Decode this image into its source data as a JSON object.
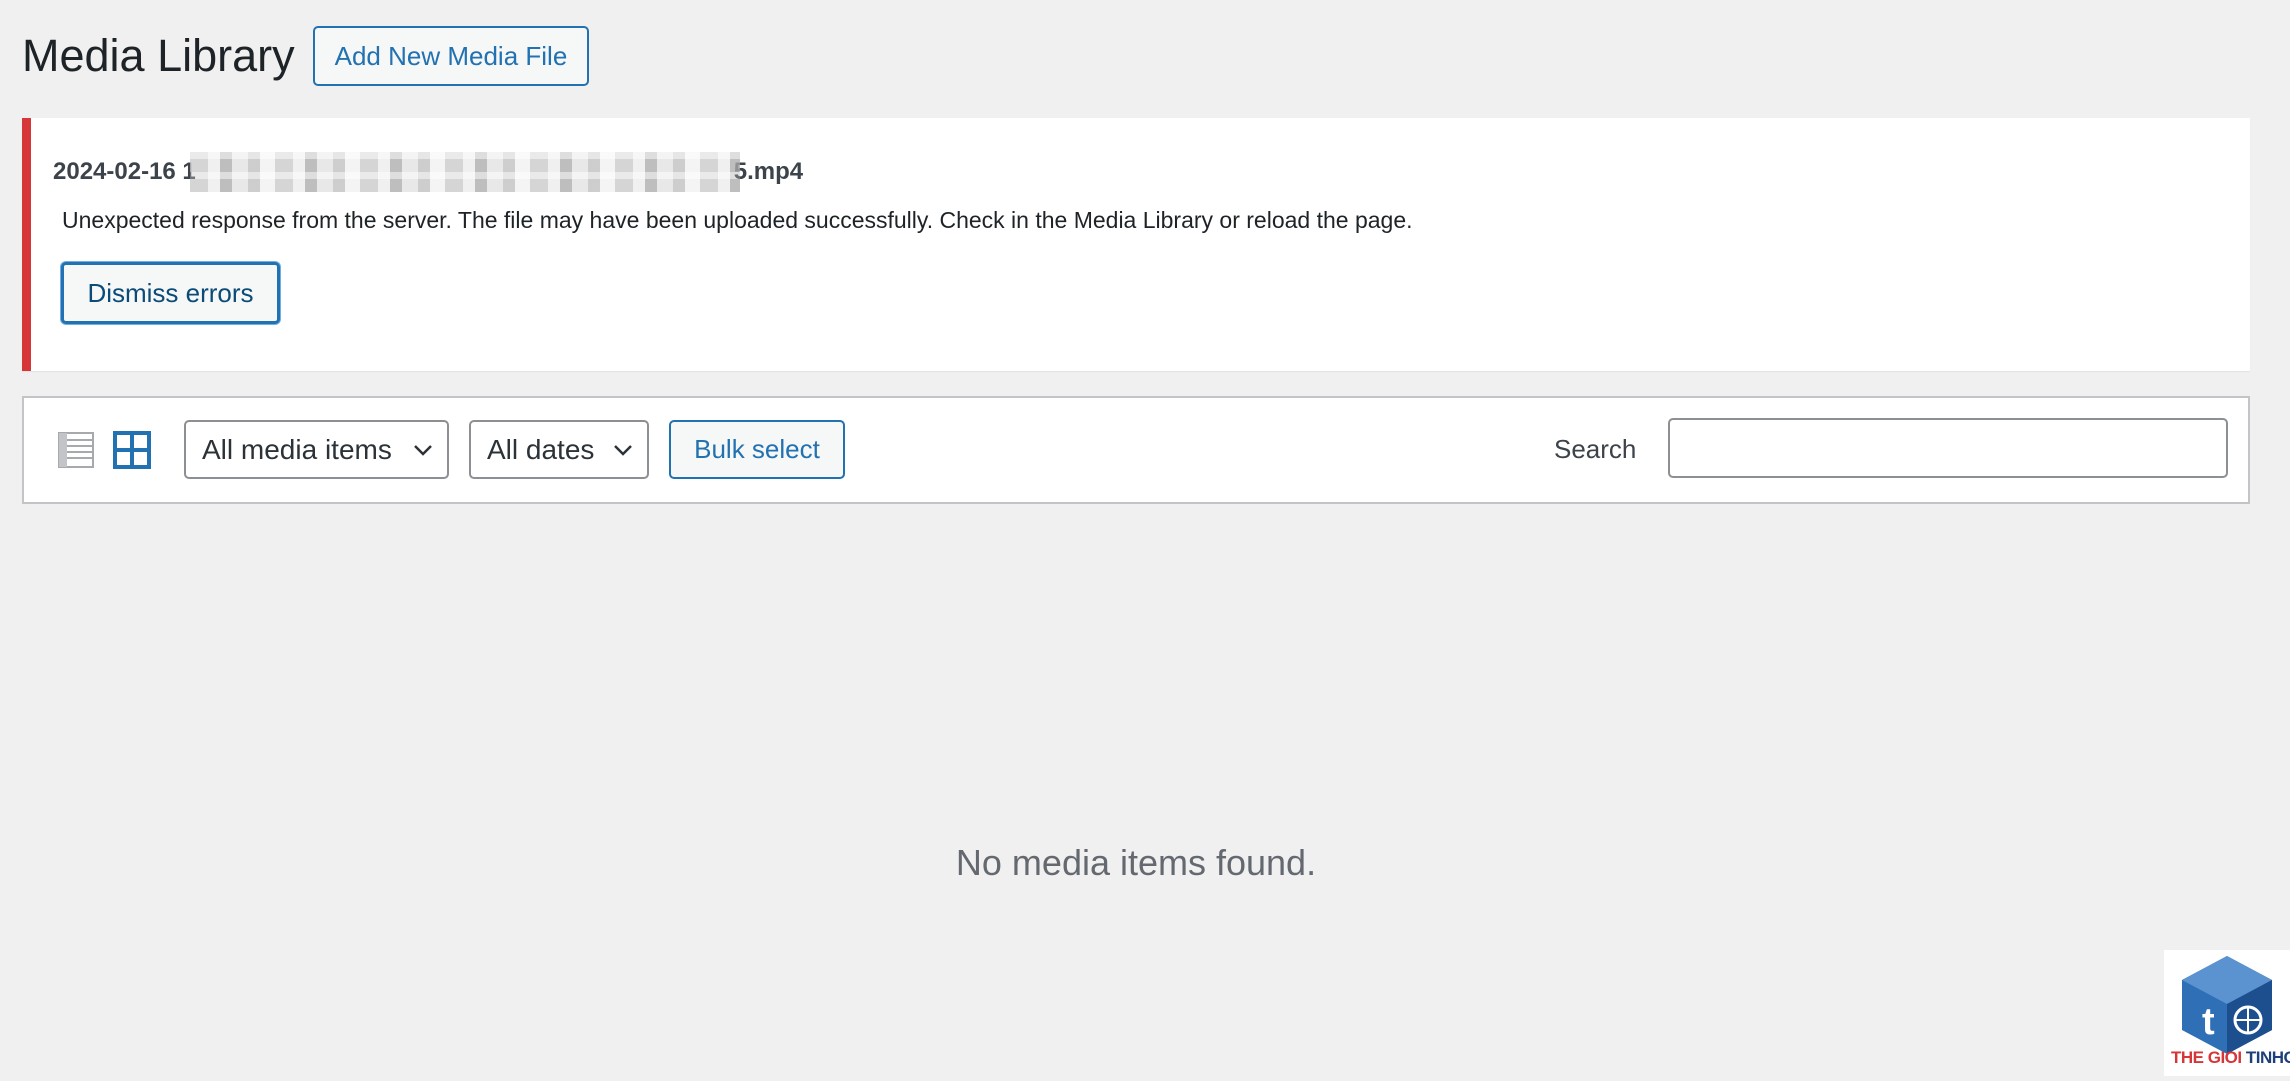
{
  "header": {
    "title": "Media Library",
    "add_new_label": "Add New Media File"
  },
  "notice": {
    "file_name_prefix": "2024-02-16 1",
    "file_name_suffix": "5.mp4",
    "message": "Unexpected response from the server. The file may have been uploaded successfully. Check in the Media Library or reload the page.",
    "dismiss_label": "Dismiss errors"
  },
  "toolbar": {
    "view_modes": [
      {
        "icon": "list-view-icon",
        "active": false
      },
      {
        "icon": "grid-view-icon",
        "active": true
      }
    ],
    "type_filter": "All media items",
    "date_filter": "All dates",
    "bulk_select_label": "Bulk select",
    "search_label": "Search",
    "search_value": ""
  },
  "main": {
    "empty_message": "No media items found."
  },
  "watermark": {
    "brand_red": "THE GIOI",
    "brand_dark": "TINHOC"
  },
  "colors": {
    "accent": "#2271b1",
    "error": "#d63638",
    "background": "#f0f0f1"
  }
}
